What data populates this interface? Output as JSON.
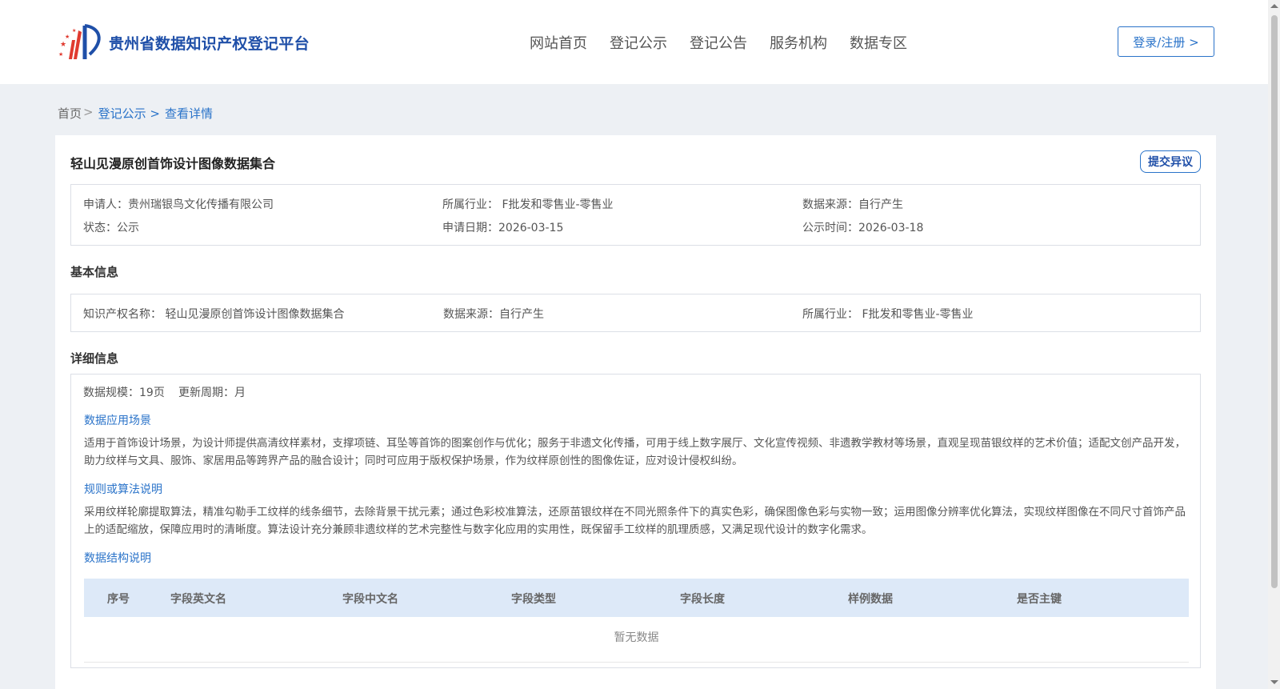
{
  "header": {
    "logo_text": "贵州省数据知识产权登记平台",
    "nav": [
      "网站首页",
      "登记公示",
      "登记公告",
      "服务机构",
      "数据专区"
    ],
    "login_label": "登录/注册 >"
  },
  "breadcrumb": {
    "home": "首页",
    "sep": ">",
    "items": [
      "登记公示 >",
      "查看详情"
    ]
  },
  "detail": {
    "title": "轻山见漫原创首饰设计图像数据集合",
    "objection_label": "提交异议",
    "summary": {
      "applicant": "申请人：贵州瑞银鸟文化传播有限公司",
      "industry": "所属行业： F批发和零售业-零售业",
      "source": "数据来源：自行产生",
      "status": "状态：公示",
      "apply_date": "申请日期：2026-03-15",
      "publish_date": "公示时间：2026-03-18"
    },
    "basic_title": "基本信息",
    "basic": {
      "ip_name": "知识产权名称： 轻山见漫原创首饰设计图像数据集合",
      "source": "数据来源：自行产生",
      "industry": "所属行业： F批发和零售业-零售业"
    },
    "detail_title": "详细信息",
    "scale": "数据规模：19页",
    "cycle": "更新周期：月",
    "scene_title": "数据应用场景",
    "scene_text": "适用于首饰设计场景，为设计师提供高清纹样素材，支撑项链、耳坠等首饰的图案创作与优化；服务于非遗文化传播，可用于线上数字展厅、文化宣传视频、非遗教学教材等场景，直观呈现苗银纹样的艺术价值；适配文创产品开发，助力纹样与文具、服饰、家居用品等跨界产品的融合设计；同时可应用于版权保护场景，作为纹样原创性的图像佐证，应对设计侵权纠纷。",
    "algo_title": "规则或算法说明",
    "algo_text": "采用纹样轮廓提取算法，精准勾勒手工纹样的线条细节，去除背景干扰元素；通过色彩校准算法，还原苗银纹样在不同光照条件下的真实色彩，确保图像色彩与实物一致；运用图像分辨率优化算法，实现纹样图像在不同尺寸首饰产品上的适配缩放，保障应用时的清晰度。算法设计充分兼顾非遗纹样的艺术完整性与数字化应用的实用性，既保留手工纹样的肌理质感，又满足现代设计的数字化需求。",
    "struct_title": "数据结构说明",
    "table": {
      "columns": [
        "序号",
        "字段英文名",
        "字段中文名",
        "字段类型",
        "字段长度",
        "样例数据",
        "是否主键"
      ],
      "empty_text": "暂无数据"
    }
  }
}
